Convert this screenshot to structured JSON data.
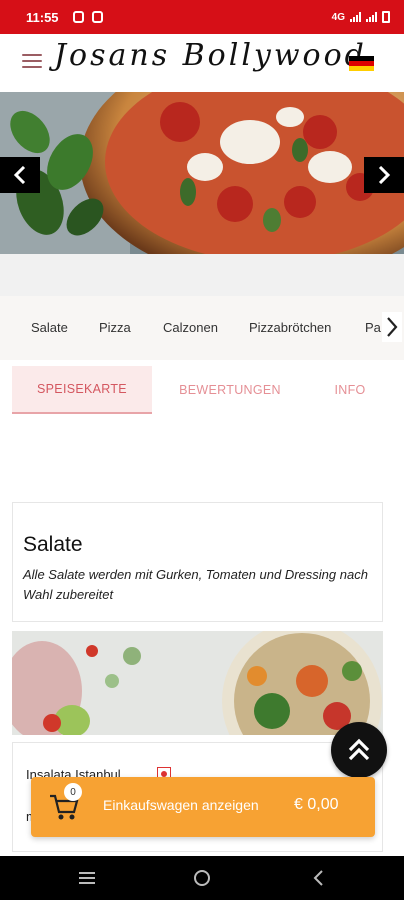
{
  "status_bar": {
    "time": "11:55",
    "network": "4G"
  },
  "header": {
    "brand": "Josans Bollywood",
    "language_flag": "flag-de-icon"
  },
  "categories": [
    "Salate",
    "Pizza",
    "Calzonen",
    "Pizzabrötchen",
    "Pa"
  ],
  "tabs": [
    {
      "label": "SPEISEKARTE",
      "active": true
    },
    {
      "label": "BEWERTUNGEN",
      "active": false
    },
    {
      "label": "INFO",
      "active": false
    }
  ],
  "section": {
    "title": "Salate",
    "description": "Alle Salate werden mit Gurken, Tomaten und Dressing nach Wahl zubereitet"
  },
  "item": {
    "name": "Insalata Istanbul",
    "sub": "m"
  },
  "cart": {
    "count": "0",
    "label": "Einkaufswagen anzeigen",
    "total": "€ 0,00"
  },
  "colors": {
    "status_bar": "#d60f17",
    "accent": "#d45760",
    "cart": "#f7a233"
  }
}
